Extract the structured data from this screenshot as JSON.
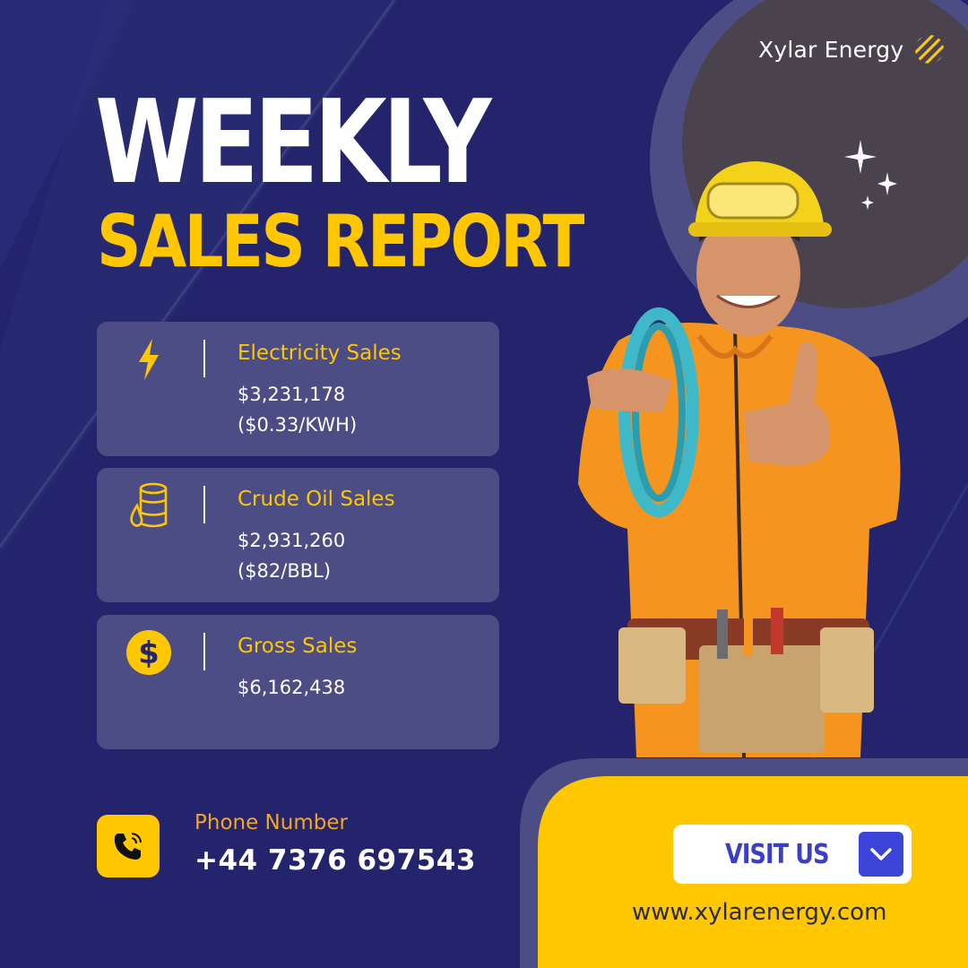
{
  "brand": {
    "name": "Xylar Energy",
    "logo_icon": "striped-circle-logo",
    "accent_color": "#ffc700"
  },
  "header": {
    "title_line1": "WEEKLY",
    "title_line2": "SALES REPORT"
  },
  "cards": [
    {
      "icon": "lightning-icon",
      "title": "Electricity Sales",
      "value_line1": "$3,231,178",
      "value_line2": "($0.33/KWH)"
    },
    {
      "icon": "oil-barrel-icon",
      "title": "Crude Oil Sales",
      "value_line1": "$2,931,260",
      "value_line2": "($82/BBL)"
    },
    {
      "icon": "dollar-coin-icon",
      "title": "Gross Sales",
      "value_line1": "$6,162,438",
      "value_line2": ""
    }
  ],
  "contact": {
    "icon": "phone-icon",
    "label": "Phone Number",
    "number": "+44 7376 697543"
  },
  "cta": {
    "button_label": "VISIT US",
    "arrow_icon": "chevron-down-icon",
    "website": "www.xylarenergy.com"
  },
  "colors": {
    "background": "#23246b",
    "card": "#4b4d84",
    "yellow": "#ffc700",
    "button_blue": "#3c43d8"
  }
}
